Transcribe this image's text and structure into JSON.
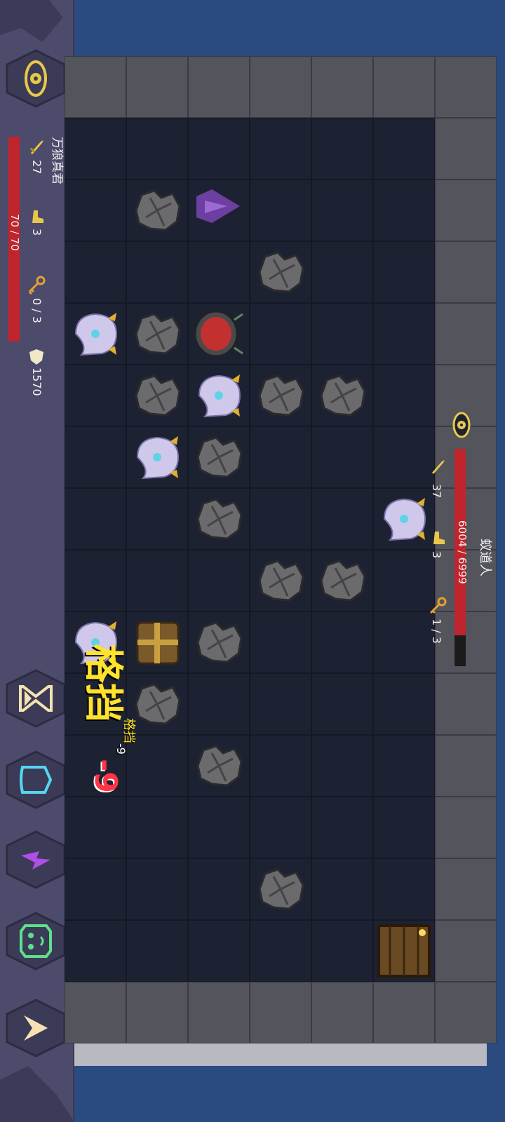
{
  "player": {
    "name": "万狼真君",
    "hp_text": "70 / 70",
    "hp_fraction": 1.0,
    "attack": "27",
    "defense": "3",
    "keys": "0 / 3",
    "gold": "1570"
  },
  "enemy": {
    "name": "蚁道人",
    "hp_text": "6004 / 6999",
    "hp_fraction": 0.858,
    "attack": "37",
    "defense": "3",
    "keys": "1 / 3"
  },
  "combat_text": {
    "block_big": "格挡",
    "block_small": "格挡",
    "small_damage": "-9",
    "red_damage": "-9"
  },
  "buttons": [
    {
      "name": "hourglass-button",
      "icon": "hourglass-icon",
      "color": "#f3e3b0"
    },
    {
      "name": "shield-button",
      "icon": "shield-icon",
      "color": "#52d8f0"
    },
    {
      "name": "lightning-button",
      "icon": "lightning-icon",
      "color": "#b04ee8"
    },
    {
      "name": "cat-mask-button",
      "icon": "cat-mask-icon",
      "color": "#5ce08a"
    },
    {
      "name": "jump-button",
      "icon": "chevron-up-icon",
      "color": "#f6e2b4"
    }
  ],
  "colors": {
    "background": "#2a4a80",
    "panel": "#4c4b6c",
    "hp_bar": "#c0242c",
    "eye_gold": "#e8c84a"
  }
}
